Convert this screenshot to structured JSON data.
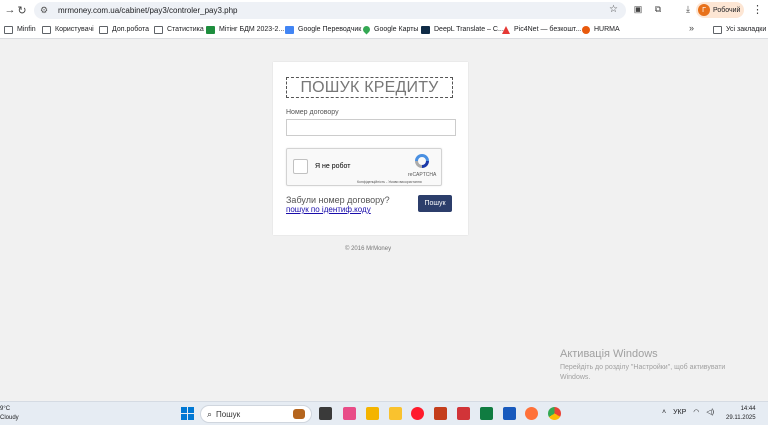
{
  "browser": {
    "url": "mrmoney.com.ua/cabinet/pay3/controler_pay3.php",
    "profile_name": "Робочий",
    "profile_initial": "Г"
  },
  "bookmarks": {
    "items": [
      {
        "label": "Minfin",
        "icon": "folder-icon"
      },
      {
        "label": "Користувачі",
        "icon": "folder-icon"
      },
      {
        "label": "Доп.робота",
        "icon": "folder-icon"
      },
      {
        "label": "Статистика",
        "icon": "folder-icon"
      },
      {
        "label": "Мітінг БДМ 2023-2...",
        "icon": "sheets-icon"
      },
      {
        "label": "Google Переводчик",
        "icon": "translate-icon"
      },
      {
        "label": "Google Карты",
        "icon": "maps-icon"
      },
      {
        "label": "DeepL Translate – C...",
        "icon": "deepl-icon"
      },
      {
        "label": "Pic4Net — безкошт...",
        "icon": "pic4net-icon"
      },
      {
        "label": "HURMA",
        "icon": "hurma-icon"
      }
    ],
    "all_bookmarks_label": "Усі закладки"
  },
  "page": {
    "title": "ПОШУК КРЕДИТУ",
    "contract_label": "Номер договору",
    "contract_value": "",
    "captcha_label": "Я не робот",
    "captcha_brand": "reCAPTCHA",
    "captcha_terms": "Конфіденційність - Умови використання",
    "forgot_text": "Забули номер договору?",
    "search_link": "пошук по ідентиф.коду",
    "submit_label": "Пошук",
    "copyright": "© 2016 MrMoney"
  },
  "watermark": {
    "title": "Активація Windows",
    "subtitle": "Перейдіть до розділу \"Настройки\", щоб активувати Windows."
  },
  "taskbar": {
    "weather_temp": "9°C",
    "weather_desc": "Cloudy",
    "search_placeholder": "Пошук",
    "language": "УКР",
    "time": "14:44",
    "date": "29.11.2025"
  }
}
